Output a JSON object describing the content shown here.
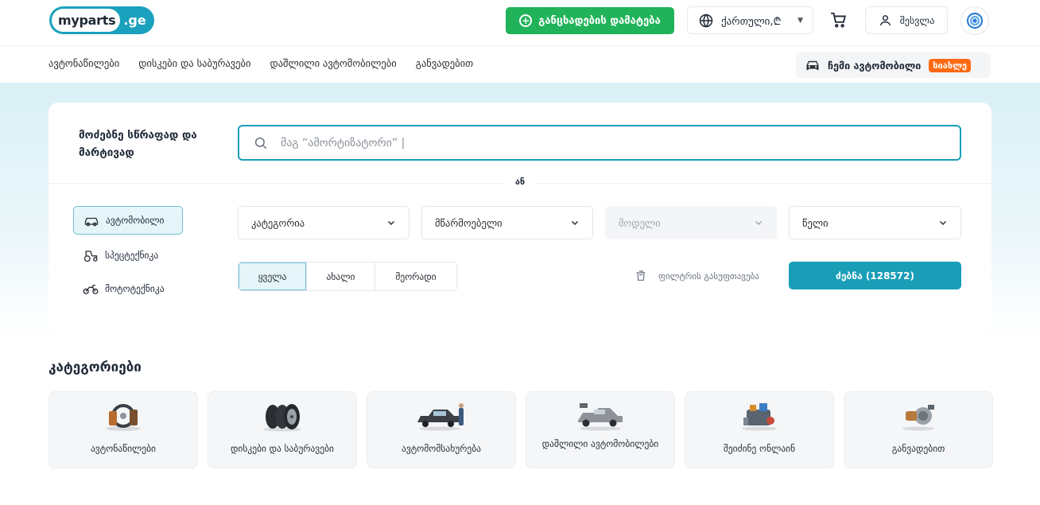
{
  "header": {
    "logo_left": "myparts",
    "logo_right": ".ge",
    "add_listing": "განცხადების დამატება",
    "language": "ქართული,₾",
    "login": "შესვლა"
  },
  "nav": {
    "items": [
      "ავტონაწილები",
      "დისკები და საბურავები",
      "დაშლილი ავტომობილები",
      "განვადებით"
    ],
    "my_car": "ჩემი ავტომობილი",
    "new_badge": "სიახლე"
  },
  "search": {
    "title": "მოძებნე სწრაფად და მარტივად",
    "placeholder": "მაგ “ამორტიზატორი” |",
    "or_label": "ან",
    "vehicle_types": [
      "ავტომობილი",
      "სპეცტექნიკა",
      "მოტოტექნიკა"
    ],
    "dropdowns": [
      "კატეგორია",
      "მწარმოებელი",
      "მოდელი",
      "წელი"
    ],
    "condition_tabs": [
      "ყველა",
      "ახალი",
      "მეორადი"
    ],
    "clear_filters": "ფილტრის გასუფთავება",
    "search_button": "ძებნა (128572)"
  },
  "categories": {
    "title": "კატეგორიები",
    "items": [
      "ავტონაწილები",
      "დისკები და საბურავები",
      "ავტომომსახურება",
      "დაშლილი ავტომობილები",
      "შეიძინე ონლაინ",
      "განვადებით"
    ]
  },
  "colors": {
    "brand": "#1aa1bd",
    "add_green": "#21b35a",
    "badge_orange": "#ff6a13"
  }
}
